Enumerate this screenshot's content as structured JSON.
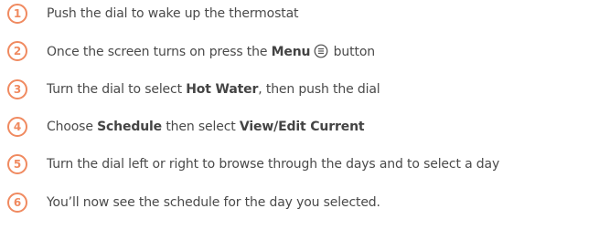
{
  "steps": [
    {
      "number": "1",
      "text": "Push the dial to wake up the thermostat"
    },
    {
      "number": "2",
      "text_before": "Once the screen turns on press the ",
      "bold": "Menu",
      "icon": "menu-circle-icon",
      "text_after": " button"
    },
    {
      "number": "3",
      "text_before": "Turn the dial to select ",
      "bold": "Hot Water",
      "text_after": ", then push the dial"
    },
    {
      "number": "4",
      "text_before": "Choose ",
      "bold": "Schedule",
      "text_middle": " then select ",
      "bold2": "View/Edit Current"
    },
    {
      "number": "5",
      "text": "Turn the dial left or right to browse through the days and to select a day"
    },
    {
      "number": "6",
      "text": "You’ll now see the schedule for the day you selected."
    }
  ],
  "colors": {
    "accent": "#f08a60",
    "text": "#4a4a4a"
  }
}
